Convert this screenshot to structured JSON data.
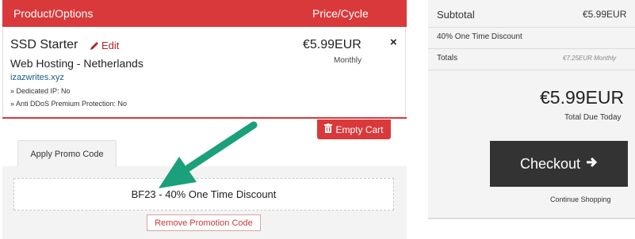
{
  "cart": {
    "header_product": "Product/Options",
    "header_price": "Price/Cycle",
    "item": {
      "name": "SSD Starter",
      "edit_label": "Edit",
      "group": "Web Hosting - Netherlands",
      "domain": "izazwrites.xyz",
      "option_1": "» Dedicated IP: No",
      "option_2": "» Anti DDoS Premium Protection: No",
      "price": "€5.99EUR",
      "cycle": "Monthly",
      "remove_symbol": "×"
    },
    "empty_cart_label": "Empty Cart",
    "icons": {
      "edit": "pencil-icon",
      "empty_cart": "trash-icon",
      "remove": "close-icon"
    }
  },
  "promo": {
    "tab_label": "Apply Promo Code",
    "applied_text": "BF23 - 40% One Time Discount",
    "remove_label": "Remove Promotion Code"
  },
  "summary": {
    "subtotal_label": "Subtotal",
    "subtotal_value": "€5.99EUR",
    "discount_label": "40% One Time Discount",
    "totals_label": "Totals",
    "totals_recurring": "€7.25EUR Monthly",
    "total_due": "€5.99EUR",
    "total_due_label": "Total Due Today",
    "checkout_label": "Checkout",
    "continue_label": "Continue Shopping",
    "icons": {
      "checkout": "arrow-right-icon"
    }
  },
  "colors": {
    "accent_red": "#d9393b",
    "arrow_green": "#1aa07a",
    "checkout_bg": "#333333"
  }
}
